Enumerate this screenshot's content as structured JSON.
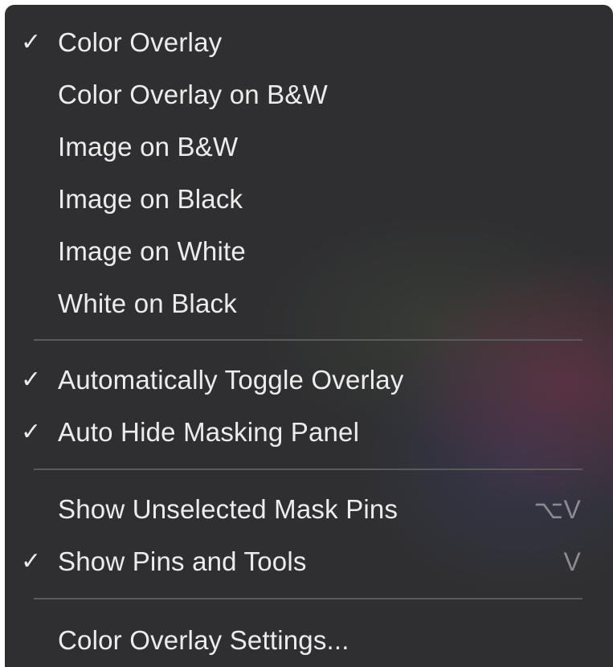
{
  "menu": {
    "check_glyph": "✓",
    "items": [
      {
        "label": "Color Overlay",
        "checked": true,
        "shortcut": ""
      },
      {
        "label": "Color Overlay on B&W",
        "checked": false,
        "shortcut": ""
      },
      {
        "label": "Image on B&W",
        "checked": false,
        "shortcut": ""
      },
      {
        "label": "Image on Black",
        "checked": false,
        "shortcut": ""
      },
      {
        "label": "Image on White",
        "checked": false,
        "shortcut": ""
      },
      {
        "label": "White on Black",
        "checked": false,
        "shortcut": ""
      },
      {
        "label": "Automatically Toggle Overlay",
        "checked": true,
        "shortcut": ""
      },
      {
        "label": "Auto Hide Masking Panel",
        "checked": true,
        "shortcut": ""
      },
      {
        "label": "Show Unselected Mask Pins",
        "checked": false,
        "shortcut": "⌥V"
      },
      {
        "label": "Show Pins and Tools",
        "checked": true,
        "shortcut": "V"
      },
      {
        "label": "Color Overlay Settings...",
        "checked": false,
        "shortcut": ""
      }
    ]
  },
  "colors": {
    "text": "#ececec",
    "shortcut_text": "#8b8b8e",
    "separator": "#5a5a5d",
    "background": "#2f2f31"
  }
}
